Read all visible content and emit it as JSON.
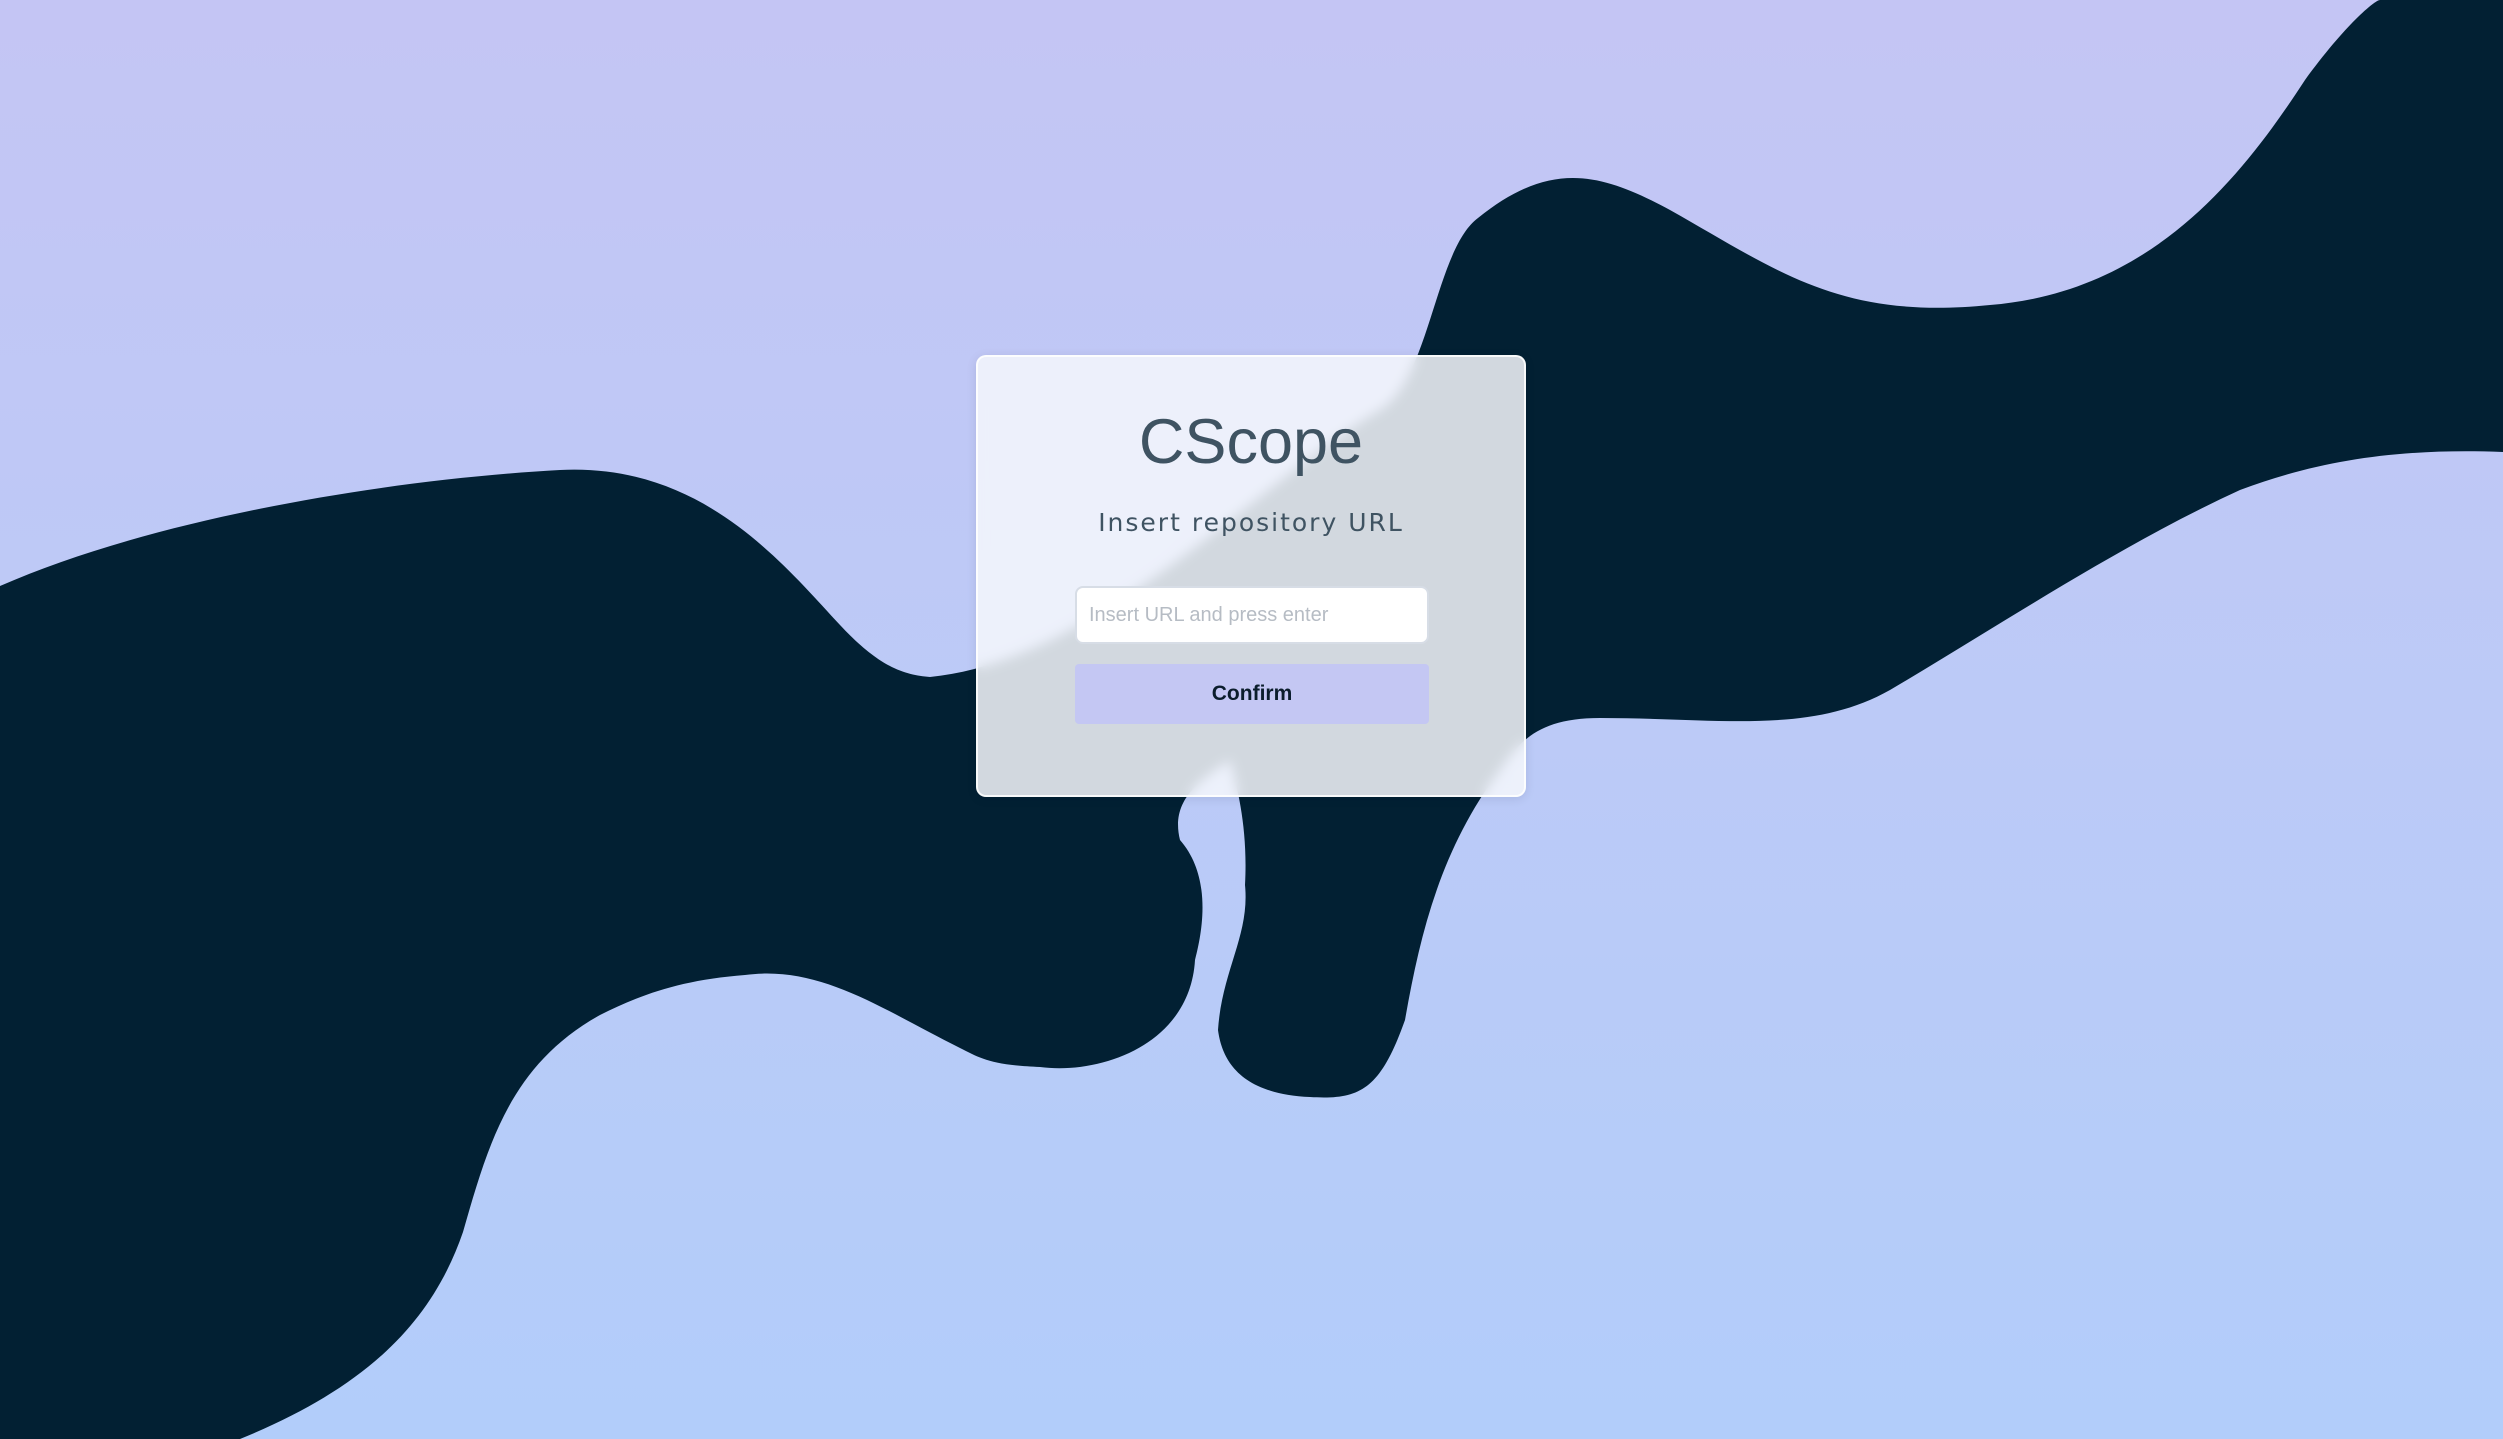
{
  "app": {
    "title": "CScope",
    "subtitle": "Insert repository URL"
  },
  "form": {
    "url_value": "",
    "url_placeholder": "Insert URL and press enter",
    "confirm_label": "Confirm"
  },
  "colors": {
    "background_top": "#c4c5f4",
    "background_bottom": "#b2cdfa",
    "wave": "#022033",
    "text": "#3f5362",
    "button": "#c4c7f3"
  }
}
